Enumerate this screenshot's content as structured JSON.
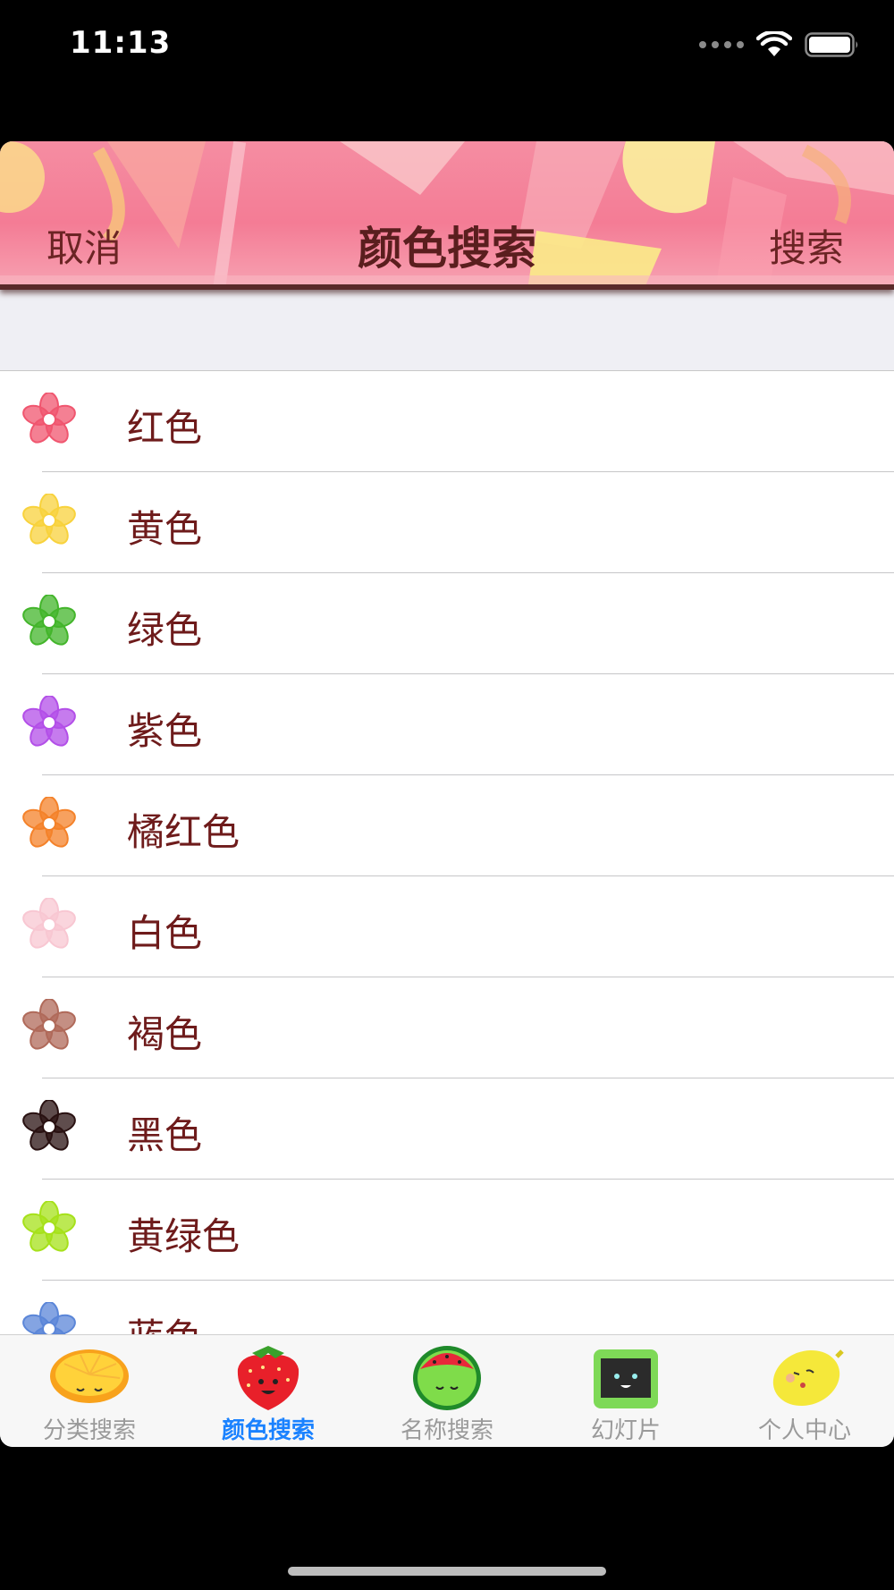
{
  "status_bar": {
    "time": "11:13"
  },
  "nav": {
    "cancel_label": "取消",
    "title": "颜色搜索",
    "search_label": "搜索"
  },
  "colors": {
    "red": "#f0566f",
    "yellow": "#f8d23c",
    "green": "#43b52b",
    "purple": "#b34fe8",
    "orange": "#f4822a",
    "white": "#f8c7d2",
    "brown": "#b06a5a",
    "black": "#2a1212",
    "yellowgreen": "#a6e11a",
    "blue": "#5b86d8",
    "text": "#6e1b1b",
    "tab_active": "#1a82ff",
    "tab_inactive": "#9a9a9a"
  },
  "list": {
    "items": [
      {
        "label": "红色",
        "icon": "red-flower-icon"
      },
      {
        "label": "黄色",
        "icon": "yellow-flower-icon"
      },
      {
        "label": "绿色",
        "icon": "green-flower-icon"
      },
      {
        "label": "紫色",
        "icon": "purple-flower-icon"
      },
      {
        "label": "橘红色",
        "icon": "orange-flower-icon"
      },
      {
        "label": "白色",
        "icon": "white-flower-icon"
      },
      {
        "label": "褐色",
        "icon": "brown-flower-icon"
      },
      {
        "label": "黑色",
        "icon": "black-flower-icon"
      },
      {
        "label": "黄绿色",
        "icon": "yellowgreen-flower-icon"
      },
      {
        "label": "蓝色",
        "icon": "blue-flower-icon"
      }
    ]
  },
  "tabs": [
    {
      "label": "分类搜索",
      "icon": "orange-slice-icon",
      "active": false
    },
    {
      "label": "颜色搜索",
      "icon": "strawberry-icon",
      "active": true
    },
    {
      "label": "名称搜索",
      "icon": "watermelon-icon",
      "active": false
    },
    {
      "label": "幻灯片",
      "icon": "tv-icon",
      "active": false
    },
    {
      "label": "个人中心",
      "icon": "lemon-icon",
      "active": false
    }
  ]
}
